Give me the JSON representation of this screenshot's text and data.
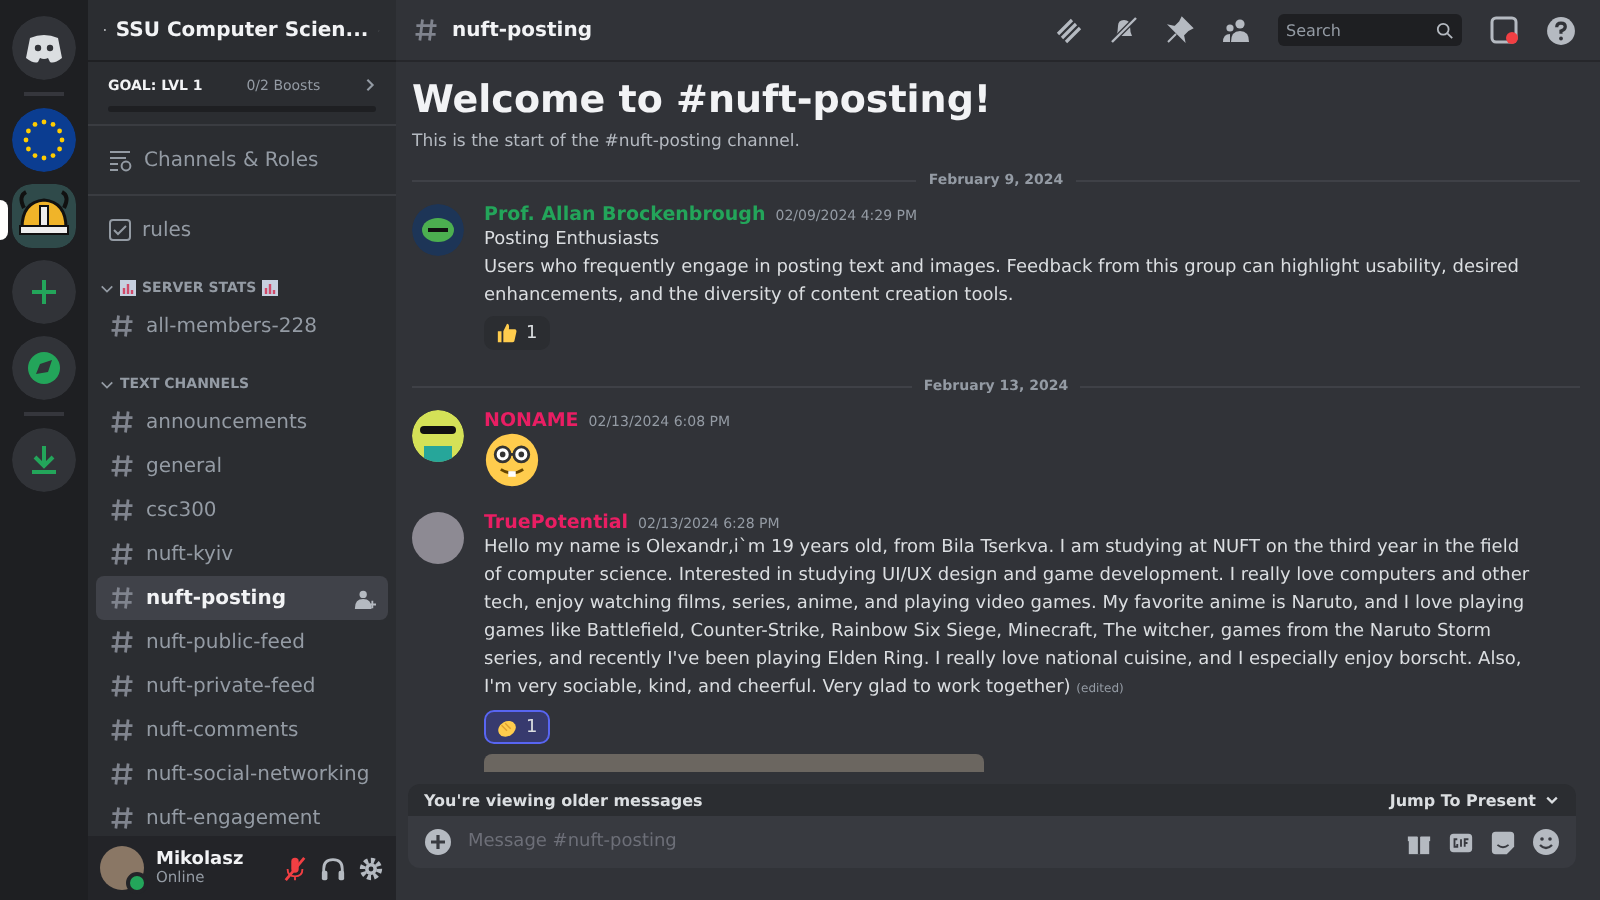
{
  "servers": [
    {
      "kind": "home",
      "selected": false
    },
    {
      "kind": "flag",
      "selected": false
    },
    {
      "kind": "helmet",
      "selected": true
    },
    {
      "kind": "add",
      "selected": false
    },
    {
      "kind": "explore",
      "selected": false
    },
    {
      "kind": "download",
      "selected": false
    }
  ],
  "sidebar": {
    "server_name": "SSU Computer Scien...",
    "goal": "GOAL: LVL 1",
    "boosts": "0/2 Boosts",
    "channels_roles": "Channels & Roles",
    "rules": "rules",
    "categories": [
      {
        "name": "SERVER STATS",
        "expanded": true,
        "channels": [
          {
            "name": "all-members-228",
            "selected": false
          }
        ]
      },
      {
        "name": "TEXT CHANNELS",
        "expanded": true,
        "channels": [
          {
            "name": "announcements",
            "selected": false
          },
          {
            "name": "general",
            "selected": false
          },
          {
            "name": "csc300",
            "selected": false
          },
          {
            "name": "nuft-kyiv",
            "selected": false
          },
          {
            "name": "nuft-posting",
            "selected": true
          },
          {
            "name": "nuft-public-feed",
            "selected": false
          },
          {
            "name": "nuft-private-feed",
            "selected": false
          },
          {
            "name": "nuft-comments",
            "selected": false
          },
          {
            "name": "nuft-social-networking",
            "selected": false
          },
          {
            "name": "nuft-engagement",
            "selected": false
          }
        ]
      }
    ]
  },
  "user": {
    "name": "Mikolasz",
    "status": "Online",
    "muted": true
  },
  "header": {
    "channel": "nuft-posting",
    "search": {
      "placeholder": "Search"
    }
  },
  "welcome": {
    "title": "Welcome to #nuft-posting!",
    "subtitle": "This is the start of the #nuft-posting channel."
  },
  "feed": [
    {
      "kind": "date",
      "text": "February 9, 2024"
    },
    {
      "kind": "message",
      "author": "Prof. Allan Brockenbrough",
      "color": "#23a55a",
      "time": "02/09/2024 4:29 PM",
      "lines": [
        "Posting Enthusiasts",
        "Users who frequently engage in posting text and images. Feedback from this group can highlight usability, desired enhancements, and the diversity of content creation tools."
      ],
      "reactions": [
        {
          "count": "1",
          "selected": false
        }
      ]
    },
    {
      "kind": "date",
      "text": "February 13, 2024"
    },
    {
      "kind": "sticker",
      "author": "NONAME",
      "color": "#e91e63",
      "time": "02/13/2024 6:08 PM"
    },
    {
      "kind": "message",
      "author": "TruePotential",
      "color": "#e91e63",
      "time": "02/13/2024 6:28 PM",
      "lines": [
        "Hello my name is Olexandr,i`m 19 years old, from Bila Tserkva. I am studying at NUFT on the third year in the field of computer science. Interested in studying UI/UX design and game development. I really love computers and other tech, enjoy watching films, series, anime, and playing video games. My favorite anime is Naruto, and I love playing games like Battlefield, Counter-Strike, Rainbow Six Siege, Minecraft, The witcher, games from the Naruto Storm series, and recently I've been playing Elden Ring. I really love national cuisine, and I especially enjoy borscht. Also, I'm very sociable, kind, and cheerful. Very glad to work together)"
      ],
      "edited": "(edited)",
      "reactions": [
        {
          "count": "1",
          "selected": true
        }
      ],
      "attachment": true
    }
  ],
  "older_bar": {
    "text": "You're viewing older messages",
    "action": "Jump To Present"
  },
  "composer": {
    "placeholder": "Message #nuft-posting"
  }
}
